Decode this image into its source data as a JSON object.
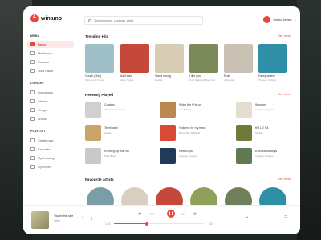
{
  "app": {
    "name": "winamp"
  },
  "search": {
    "placeholder": "Search songs, podcast, artist"
  },
  "user": {
    "name": "Sotoro James"
  },
  "sidebar": {
    "menu_label": "MENU",
    "menu": [
      {
        "label": "Home",
        "icon": "home-icon",
        "active": true
      },
      {
        "label": "Mix for you",
        "icon": "mix-icon"
      },
      {
        "label": "Podcast",
        "icon": "podcast-icon"
      },
      {
        "label": "Start Radio",
        "icon": "radio-icon"
      }
    ],
    "library_label": "LIBRARY",
    "library": [
      {
        "label": "Downloads",
        "icon": "download-icon"
      },
      {
        "label": "Albums",
        "icon": "album-icon"
      },
      {
        "label": "Songs",
        "icon": "music-note-icon"
      },
      {
        "label": "Artists",
        "icon": "artist-icon"
      }
    ],
    "playlist_label": "PLAYLIST",
    "playlist": [
      {
        "label": "Create new",
        "icon": "plus-icon"
      },
      {
        "label": "Favorites",
        "icon": "heart-icon"
      },
      {
        "label": "Mylovesongs",
        "icon": "playlist-icon"
      },
      {
        "label": "Gymvibes",
        "icon": "playlist-icon"
      }
    ]
  },
  "trending": {
    "title": "Trending Hits",
    "see_more": "See more",
    "items": [
      {
        "title": "Cough (Odo)",
        "artist": "KiDi Zerah 6 more",
        "color": "#9fc0c7"
      },
      {
        "title": "As it was",
        "artist": "Harry Styles",
        "color": "#c4493a"
      },
      {
        "title": "Stand strong",
        "artist": "Davido",
        "color": "#d6cdb4"
      },
      {
        "title": "I like you",
        "artist": "Post Malone ft Doja Cat",
        "color": "#7c8a5a"
      },
      {
        "title": "Rush",
        "artist": "Ayra Starr",
        "color": "#c9c1b3"
      },
      {
        "title": "Fancy waters",
        "artist": "Phase ft Jackyey",
        "color": "#2f8fa6"
      }
    ]
  },
  "recent": {
    "title": "Recently Played",
    "see_more": "See more",
    "items": [
      {
        "title": "Cowboy",
        "artist": "Charlotte Lawrence",
        "color": "#cfd0cf"
      },
      {
        "title": "Woke the F*ck up",
        "artist": "Jon Bellion",
        "color": "#b98a4f"
      },
      {
        "title": "Wrecked",
        "artist": "Imagine Dragons",
        "color": "#e3ddd2"
      },
      {
        "title": "Terminator",
        "artist": "Asake",
        "color": "#c7a56b"
      },
      {
        "title": "Hold me for my hand",
        "artist": "Burna Boy ft Burna",
        "color": "#d84a34"
      },
      {
        "title": "KU LO SA",
        "artist": "Oxlade",
        "color": "#6f7a3c"
      },
      {
        "title": "Running up that hill",
        "artist": "Kate Bush",
        "color": "#c9c9c9"
      },
      {
        "title": "Next to you",
        "artist": "Imagine Dragons",
        "color": "#203a5a"
      },
      {
        "title": "A thousand ways",
        "artist": "Imagine Dragons",
        "color": "#5f7b56"
      }
    ]
  },
  "favourites": {
    "title": "Favourite artists",
    "see_more": "See more",
    "colors": [
      "#7a9ea8",
      "#d8cfc2",
      "#c4493a",
      "#8ea05a",
      "#6e8058",
      "#2f8fa6"
    ]
  },
  "player": {
    "title": "You're the one",
    "artist": "Kaine",
    "elapsed": "1:24",
    "total": "3:21",
    "progress": 0.37,
    "volume": 0.55
  }
}
